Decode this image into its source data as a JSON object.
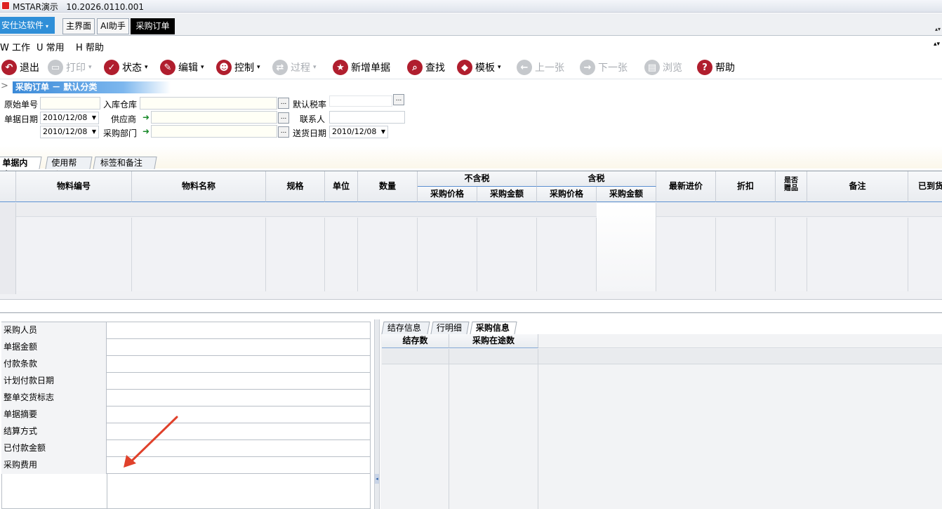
{
  "window": {
    "title": "MSTAR演示",
    "version": "10.2026.0110.001"
  },
  "brand": {
    "label": "安仕达软件"
  },
  "tabs": [
    {
      "label": "主界面"
    },
    {
      "label": "AI助手"
    },
    {
      "label": "采购订单"
    }
  ],
  "menu": [
    {
      "key": "W",
      "label": "工作"
    },
    {
      "key": "U",
      "label": "常用"
    },
    {
      "key": "H",
      "label": "帮助"
    }
  ],
  "toolbar": {
    "exit": "退出",
    "print": "打印",
    "status": "状态",
    "edit": "编辑",
    "control": "控制",
    "process": "过程",
    "new_doc": "新增单据",
    "find": "查找",
    "template": "模板",
    "prev": "上一张",
    "next": "下一张",
    "browse": "浏览",
    "help": "帮助"
  },
  "section": {
    "title": "采购订单 － 默认分类"
  },
  "form": {
    "orig_no": "原始单号",
    "warehouse": "入库仓库",
    "tax_rate": "默认税率",
    "doc_date": "单据日期",
    "doc_date_value": "2010/12/08",
    "supplier": "供应商",
    "contact": "联系人",
    "date2_value": "2010/12/08",
    "purchase_dept": "采购部门",
    "delivery_date": "送货日期",
    "delivery_date_value": "2010/12/08",
    "ellipsis": "..."
  },
  "grid_tabs": [
    {
      "label": "单据内容"
    },
    {
      "label": "使用帮助"
    },
    {
      "label": "标签和备注"
    }
  ],
  "grid": {
    "material_code": "物料编号",
    "material_name": "物料名称",
    "spec": "规格",
    "unit": "单位",
    "qty": "数量",
    "no_tax": "不含税",
    "with_tax": "含税",
    "price": "采购价格",
    "amount": "采购金额",
    "latest_price": "最新进价",
    "discount": "折扣",
    "is_gift": "是否赠品",
    "remark": "备注",
    "arrived": "已到货"
  },
  "props": [
    {
      "label": "采购人员"
    },
    {
      "label": "单据金额"
    },
    {
      "label": "付款条款"
    },
    {
      "label": "计划付款日期"
    },
    {
      "label": "整单交货标志"
    },
    {
      "label": "单据摘要"
    },
    {
      "label": "结算方式"
    },
    {
      "label": "已付款金额"
    },
    {
      "label": "采购费用"
    }
  ],
  "right_tabs": [
    {
      "label": "结存信息"
    },
    {
      "label": "行明细"
    },
    {
      "label": "采购信息"
    }
  ],
  "right_grid": {
    "stock": "结存数",
    "in_transit": "采购在途数"
  },
  "colors": {
    "brand": "#2f8fd8",
    "icon_red": "#b01e2e",
    "annotation_arrow": "#e0412b"
  }
}
